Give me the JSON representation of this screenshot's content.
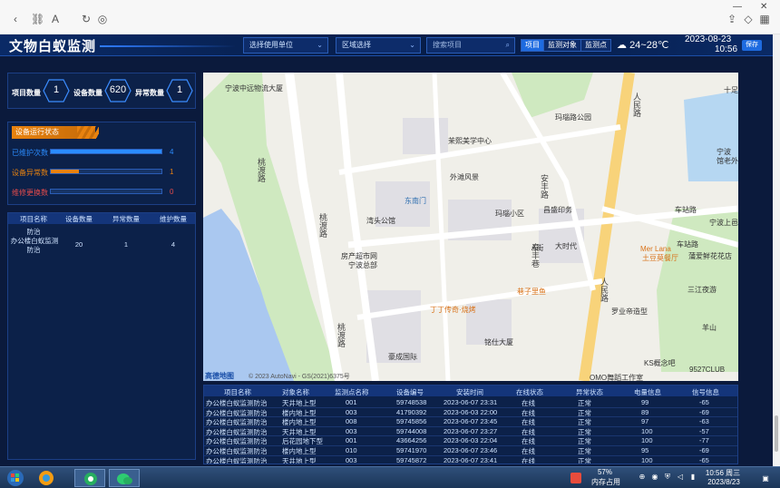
{
  "app": {
    "title": "文物白蚁监测",
    "unit_select": "选择使用单位",
    "region_select": "区域选择",
    "search_placeholder": "搜索项目",
    "tabs": [
      "项目",
      "监测对象",
      "监测点"
    ],
    "weather": "24~28℃",
    "date": "2023-08-23",
    "time": "10:56",
    "save_label": "保存"
  },
  "stats": [
    {
      "label": "项目数量",
      "value": "1"
    },
    {
      "label": "设备数量",
      "value": "620"
    },
    {
      "label": "异常数量",
      "value": "1"
    }
  ],
  "status": {
    "title": "设备运行状态",
    "rows": [
      {
        "label": "已维护次数",
        "value": "4",
        "fraction": 1.0,
        "color": "#2b8cff"
      },
      {
        "label": "设备异常数",
        "value": "1",
        "fraction": 0.25,
        "color": "#e8820f"
      },
      {
        "label": "维修更换数",
        "value": "0",
        "fraction": 0.0,
        "color": "#e34b4b"
      }
    ]
  },
  "project_table": {
    "headers": [
      "项目名称",
      "设备数量",
      "异常数量",
      "维护数量"
    ],
    "partial_row": "防治",
    "row": {
      "name_line1": "办公楼白蚁监测",
      "name_line2": "防治",
      "devices": "20",
      "abnormal": "1",
      "maintained": "4"
    }
  },
  "map": {
    "pois": [
      "宁波中远物流大厦",
      "茉熙美学中心",
      "外滩风景",
      "东南门",
      "湾头公馆",
      "玛瑙小区",
      "昌盛印务",
      "A街",
      "大时代",
      "房产超市网",
      "宁波总部",
      "巷子里鱼",
      "丁丁传奇·烧烤",
      "铭仕大厦",
      "豪成国际",
      "玛瑙路公园",
      "宁波",
      "馆老外",
      "宁波上邑",
      "车站路",
      "Mer Lana",
      "土豆莫餐厅",
      "蒲爱鲜花花店",
      "三江夜游",
      "罗业帝造型",
      "羊山",
      "KS概念吧",
      "9527CLUB",
      "OMO舞蹈工作室",
      "十足"
    ],
    "roads": [
      "桃渡路",
      "桃渡路",
      "桃渡路",
      "人民路",
      "人民路",
      "车站路",
      "安丰路",
      "泰丰巷"
    ],
    "credit": "© 2023 AutoNavi - GS(2021)6375号",
    "logo": "高德地图"
  },
  "device_table": {
    "headers": [
      "项目名称",
      "对象名称",
      "监测点名称",
      "设备编号",
      "安装时间",
      "在线状态",
      "异常状态",
      "电量信息",
      "信号信息"
    ],
    "rows": [
      [
        "办公楼白蚁监测防治",
        "天井地上型",
        "001",
        "59748538",
        "2023-06-07 23:31",
        "在线",
        "正常",
        "99",
        "-65"
      ],
      [
        "办公楼白蚁监测防治",
        "楼内地上型",
        "003",
        "41790392",
        "2023-06-03 22:00",
        "在线",
        "正常",
        "89",
        "-69"
      ],
      [
        "办公楼白蚁监测防治",
        "楼内地上型",
        "008",
        "59745856",
        "2023-06-07 23:45",
        "在线",
        "正常",
        "97",
        "-63"
      ],
      [
        "办公楼白蚁监测防治",
        "天井地上型",
        "003",
        "59744008",
        "2023-06-07 23:27",
        "在线",
        "正常",
        "100",
        "-57"
      ],
      [
        "办公楼白蚁监测防治",
        "后花园地下型",
        "001",
        "43664256",
        "2023-06-03 22:04",
        "在线",
        "正常",
        "100",
        "-77"
      ],
      [
        "办公楼白蚁监测防治",
        "楼内地上型",
        "010",
        "59741970",
        "2023-06-07 23:46",
        "在线",
        "正常",
        "95",
        "-69"
      ],
      [
        "办公楼白蚁监测防治",
        "天井地上型",
        "003",
        "59745872",
        "2023-06-07 23:41",
        "在线",
        "正常",
        "100",
        "-65"
      ]
    ]
  },
  "taskbar": {
    "memory_percent": "57%",
    "memory_label": "内存占用",
    "clock_time": "10:56 周三",
    "clock_date": "2023/8/23"
  }
}
